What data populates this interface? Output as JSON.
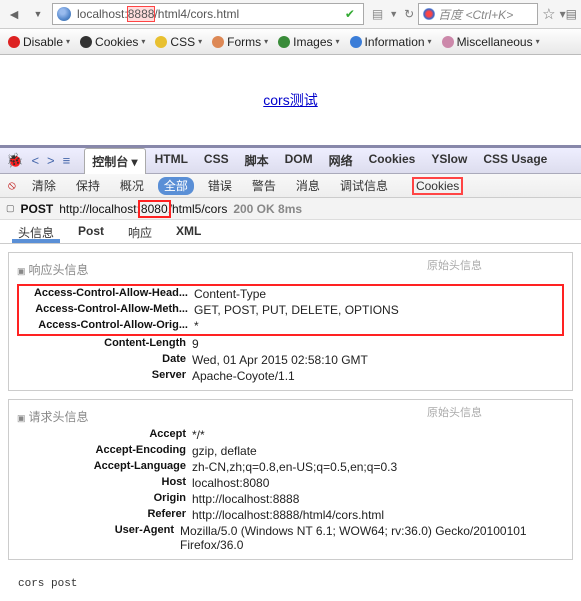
{
  "address_bar": {
    "host": "localhost",
    "port": "8888",
    "path": "html4/cors.html",
    "search_placeholder": "百度 <Ctrl+K>"
  },
  "ext_toolbar": {
    "items": [
      {
        "label": "Disable",
        "color": "#d22"
      },
      {
        "label": "Cookies",
        "color": "#333"
      },
      {
        "label": "CSS",
        "color": "#e8c030"
      },
      {
        "label": "Forms",
        "color": "#d85"
      },
      {
        "label": "Images",
        "color": "#3a8c3a"
      },
      {
        "label": "Information",
        "color": "#3b7dd8"
      },
      {
        "label": "Miscellaneous",
        "color": "#c8a"
      }
    ]
  },
  "page": {
    "link_text": "cors测试"
  },
  "devtools": {
    "tabs": [
      "控制台",
      "HTML",
      "CSS",
      "脚本",
      "DOM",
      "网络",
      "Cookies",
      "YSlow",
      "CSS Usage"
    ],
    "active_tab": "控制台",
    "subbar": [
      "清除",
      "保持",
      "概况",
      "全部",
      "错误",
      "警告",
      "消息",
      "调试信息",
      "Cookies"
    ],
    "subbar_active": "全部"
  },
  "request": {
    "method": "POST",
    "url_pre": "http://localhost",
    "url_port": "8080",
    "url_post": "html5/cors",
    "status": "200 OK 8ms"
  },
  "subtabs": {
    "items": [
      "头信息",
      "Post",
      "响应",
      "XML"
    ],
    "active": "头信息"
  },
  "resp": {
    "title": "响应头信息",
    "raw": "原始头信息",
    "red": [
      {
        "k": "Access-Control-Allow-Head...",
        "v": "Content-Type"
      },
      {
        "k": "Access-Control-Allow-Meth...",
        "v": "GET, POST, PUT, DELETE, OPTIONS"
      },
      {
        "k": "Access-Control-Allow-Orig...",
        "v": "*"
      }
    ],
    "rest": [
      {
        "k": "Content-Length",
        "v": "9"
      },
      {
        "k": "Date",
        "v": "Wed, 01 Apr 2015 02:58:10 GMT"
      },
      {
        "k": "Server",
        "v": "Apache-Coyote/1.1"
      }
    ]
  },
  "reqh": {
    "title": "请求头信息",
    "raw": "原始头信息",
    "rows": [
      {
        "k": "Accept",
        "v": "*/*"
      },
      {
        "k": "Accept-Encoding",
        "v": "gzip, deflate"
      },
      {
        "k": "Accept-Language",
        "v": "zh-CN,zh;q=0.8,en-US;q=0.5,en;q=0.3"
      },
      {
        "k": "Host",
        "v": "localhost:8080"
      },
      {
        "k": "Origin",
        "v": "http://localhost:8888"
      },
      {
        "k": "Referer",
        "v": "http://localhost:8888/html4/cors.html"
      },
      {
        "k": "User-Agent",
        "v": "Mozilla/5.0 (Windows NT 6.1; WOW64; rv:36.0) Gecko/20100101 Firefox/36.0"
      }
    ]
  },
  "console": {
    "log": "cors post"
  }
}
